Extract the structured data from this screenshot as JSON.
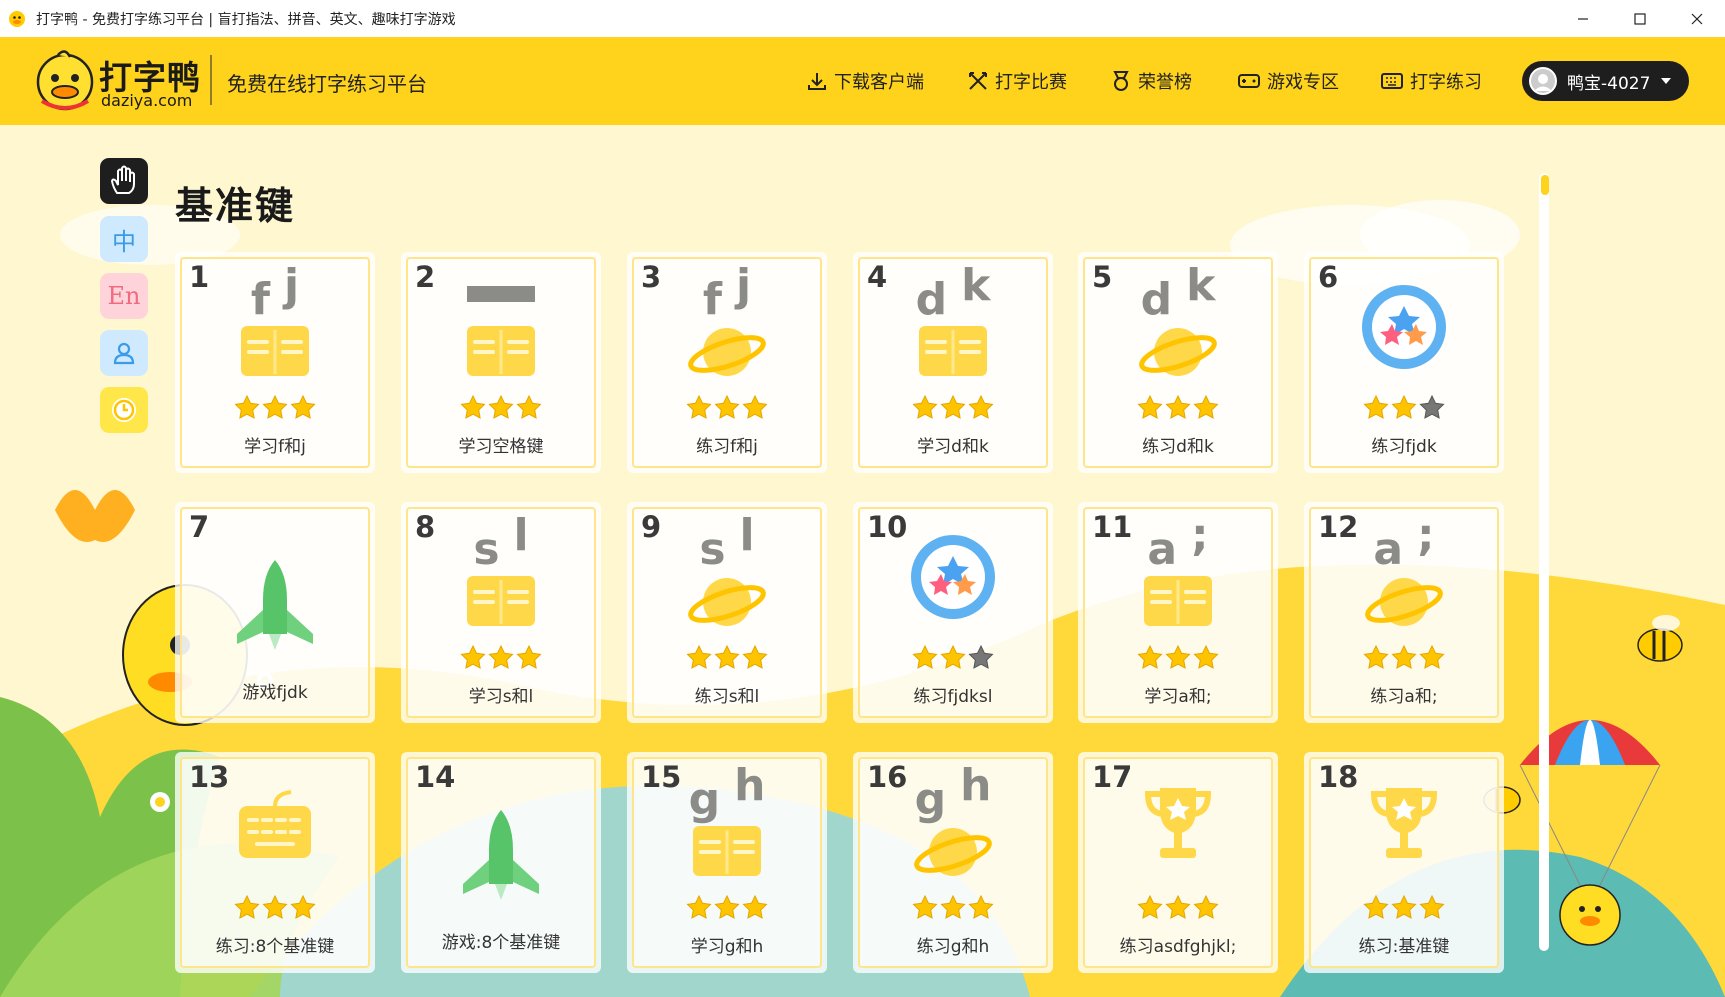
{
  "window": {
    "title": "打字鸭 - 免费打字练习平台 | 盲打指法、拼音、英文、趣味打字游戏"
  },
  "header": {
    "brand_cn": "打字鸭",
    "brand_en": "daziya.com",
    "slogan": "免费在线打字练习平台",
    "nav": [
      {
        "label": "下载客户端",
        "icon": "download-icon"
      },
      {
        "label": "打字比赛",
        "icon": "competition-icon"
      },
      {
        "label": "荣誉榜",
        "icon": "medal-icon"
      },
      {
        "label": "游戏专区",
        "icon": "gamepad-icon"
      },
      {
        "label": "打字练习",
        "icon": "keyboard-icon"
      }
    ],
    "user": {
      "name": "鸭宝-4027"
    }
  },
  "sidebar": {
    "items": [
      {
        "label": "",
        "icon": "hand-icon",
        "active": true
      },
      {
        "label": "中",
        "icon": "chinese-icon"
      },
      {
        "label": "En",
        "icon": "english-icon"
      },
      {
        "label": "",
        "icon": "user-icon"
      },
      {
        "label": "",
        "icon": "history-icon"
      }
    ]
  },
  "section": {
    "title": "基准键"
  },
  "lessons": [
    {
      "num": "1",
      "keys": [
        "f",
        "j"
      ],
      "icon": "book-icon",
      "stars": 3,
      "label": "学习f和j"
    },
    {
      "num": "2",
      "keys": [],
      "space": true,
      "icon": "book-icon",
      "stars": 3,
      "label": "学习空格键"
    },
    {
      "num": "3",
      "keys": [
        "f",
        "j"
      ],
      "icon": "planet-icon",
      "stars": 3,
      "label": "练习f和j"
    },
    {
      "num": "4",
      "keys": [
        "d",
        "k"
      ],
      "icon": "book-icon",
      "stars": 3,
      "label": "学习d和k"
    },
    {
      "num": "5",
      "keys": [
        "d",
        "k"
      ],
      "icon": "planet-icon",
      "stars": 3,
      "label": "练习d和k"
    },
    {
      "num": "6",
      "keys": [],
      "icon": "star-badge-icon",
      "stars": 2,
      "label": "练习fjdk"
    },
    {
      "num": "7",
      "keys": [],
      "icon": "rocket-icon",
      "stars": 0,
      "label": "游戏fjdk"
    },
    {
      "num": "8",
      "keys": [
        "s",
        "l"
      ],
      "icon": "book-icon",
      "stars": 3,
      "label": "学习s和l"
    },
    {
      "num": "9",
      "keys": [
        "s",
        "l"
      ],
      "icon": "planet-icon",
      "stars": 3,
      "label": "练习s和l"
    },
    {
      "num": "10",
      "keys": [],
      "icon": "star-badge-icon",
      "stars": 2,
      "label": "练习fjdksl"
    },
    {
      "num": "11",
      "keys": [
        "a",
        ";"
      ],
      "icon": "book-icon",
      "stars": 3,
      "label": "学习a和;"
    },
    {
      "num": "12",
      "keys": [
        "a",
        ";"
      ],
      "icon": "planet-icon",
      "stars": 3,
      "label": "练习a和;"
    },
    {
      "num": "13",
      "keys": [],
      "icon": "keyboard-icon",
      "stars": 3,
      "label": "练习:8个基准键"
    },
    {
      "num": "14",
      "keys": [],
      "icon": "rocket-icon",
      "stars": 0,
      "label": "游戏:8个基准键"
    },
    {
      "num": "15",
      "keys": [
        "g",
        "h"
      ],
      "icon": "book-icon",
      "stars": 3,
      "label": "学习g和h"
    },
    {
      "num": "16",
      "keys": [
        "g",
        "h"
      ],
      "icon": "planet-icon",
      "stars": 3,
      "label": "练习g和h"
    },
    {
      "num": "17",
      "keys": [],
      "icon": "trophy-icon",
      "stars": 3,
      "label": "练习asdfghjkl;"
    },
    {
      "num": "18",
      "keys": [],
      "icon": "trophy-icon",
      "stars": 3,
      "label": "练习:基准键"
    }
  ],
  "colors": {
    "brand_yellow": "#ffd21c",
    "page_bg": "#fff7d0",
    "star": "#ffc400",
    "star_empty": "#777777",
    "text_dark": "#1a1a1a"
  }
}
